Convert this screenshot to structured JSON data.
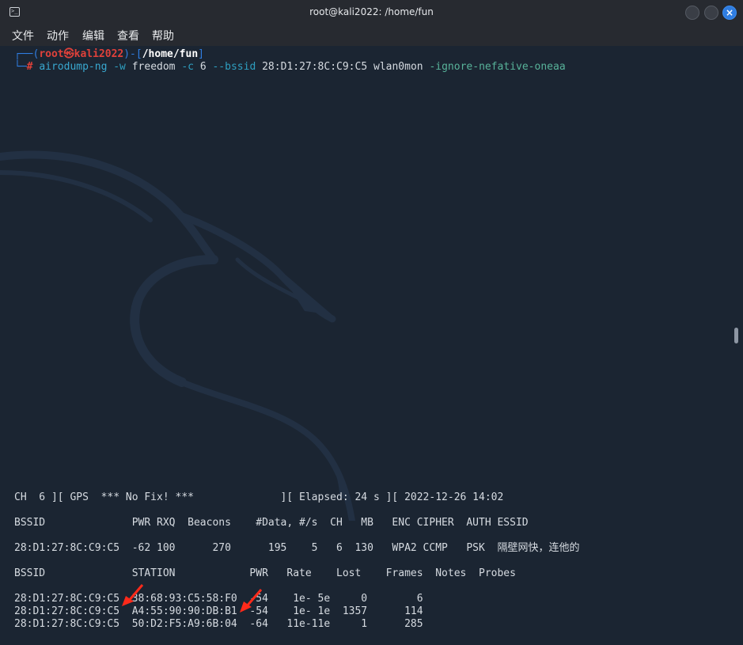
{
  "window": {
    "title": "root@kali2022: /home/fun",
    "icon": "terminal-icon"
  },
  "menu": {
    "items": [
      "文件",
      "动作",
      "编辑",
      "查看",
      "帮助"
    ]
  },
  "prompt": {
    "open": "┌──(",
    "user": "root㉿kali2022",
    "mid": ")-[",
    "path": "/home/fun",
    "close": "]",
    "hash_prefix": "└─",
    "hash": "#",
    "command": {
      "program": "airodump-ng",
      "opt_w": "-w",
      "arg_w": "freedom",
      "opt_c": "-c",
      "arg_c": "6",
      "opt_bssid": "--bssid",
      "arg_bssid": "28:D1:27:8C:C9:C5",
      "iface": "wlan0mon",
      "extra": "-ignore-nefative-oneaa"
    }
  },
  "airodump": {
    "status": "CH  6 ][ GPS  *** No Fix! ***              ][ Elapsed: 24 s ][ 2022-12-26 14:02",
    "ap_header": "BSSID              PWR RXQ  Beacons    #Data, #/s  CH   MB   ENC CIPHER  AUTH ESSID",
    "ap_rows": [
      "28:D1:27:8C:C9:C5  -62 100      270      195    5   6  130   WPA2 CCMP   PSK  隔壁网快，连他的"
    ],
    "station_header": "BSSID              STATION            PWR   Rate    Lost    Frames  Notes  Probes",
    "station_rows": [
      "28:D1:27:8C:C9:C5  38:68:93:C5:58:F0  -54    1e- 5e     0        6",
      "28:D1:27:8C:C9:C5  A4:55:90:90:DB:B1  -54    1e- 1e  1357      114",
      "28:D1:27:8C:C9:C5  50:D2:F5:A9:6B:04  -64   11e-11e     1      285"
    ]
  },
  "colors": {
    "background": "#1b2532",
    "titlebar": "#272a30",
    "prompt_box": "#2f7de1",
    "prompt_user": "#e0413a",
    "annotation_arrow": "#ff2a1a"
  }
}
